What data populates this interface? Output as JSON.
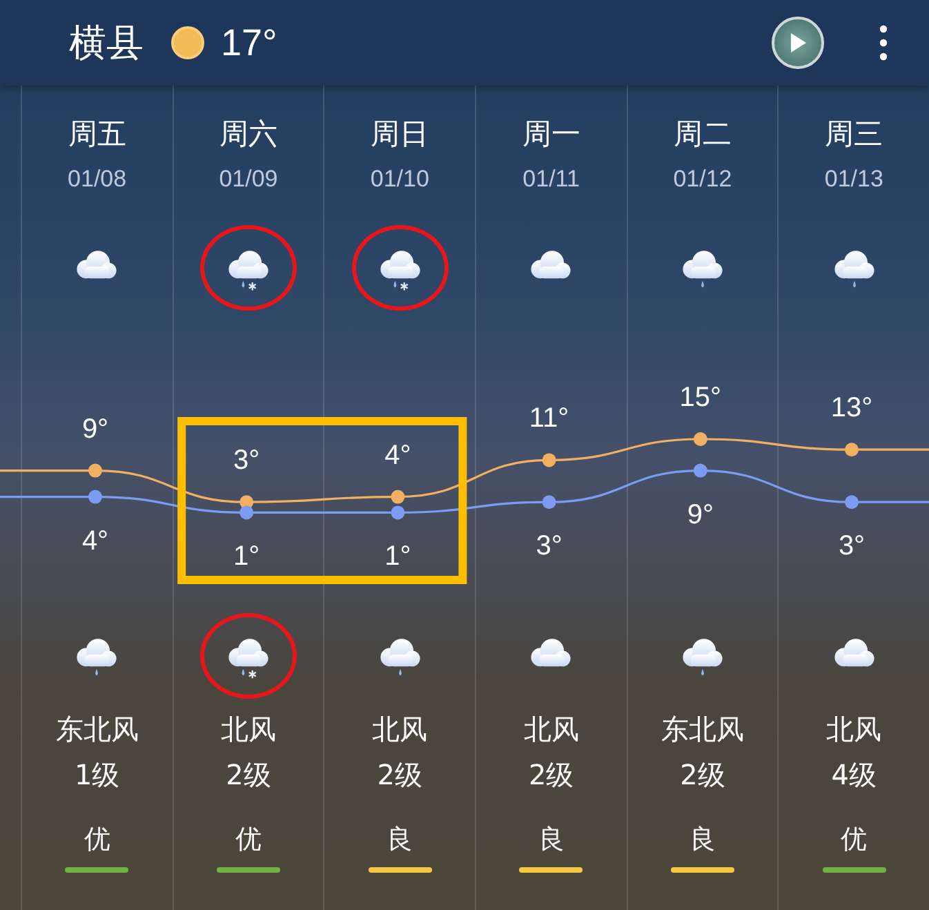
{
  "header": {
    "city": "横县",
    "temperature": "17°"
  },
  "days": [
    {
      "weekday": "周五",
      "date": "01/08",
      "day_weather": {
        "kind": "cloudy",
        "circled": false
      },
      "high": "9°",
      "low": "4°",
      "boxed": false,
      "night_weather": {
        "kind": "rain",
        "circled": false
      },
      "wind_direction": "东北风",
      "wind_level": "1级",
      "aqi": "优",
      "color": "#6db33f"
    },
    {
      "weekday": "周六",
      "date": "01/09",
      "day_weather": {
        "kind": "sleet",
        "circled": true
      },
      "high": "3°",
      "low": "1°",
      "boxed": true,
      "night_weather": {
        "kind": "sleet",
        "circled": true
      },
      "wind_direction": "北风",
      "wind_level": "2级",
      "aqi": "优",
      "color": "#6db33f"
    },
    {
      "weekday": "周日",
      "date": "01/10",
      "day_weather": {
        "kind": "sleet",
        "circled": true
      },
      "high": "4°",
      "low": "1°",
      "boxed": true,
      "night_weather": {
        "kind": "rain",
        "circled": false
      },
      "wind_direction": "北风",
      "wind_level": "2级",
      "aqi": "良",
      "color": "#f5c842"
    },
    {
      "weekday": "周一",
      "date": "01/11",
      "day_weather": {
        "kind": "cloudy",
        "circled": false
      },
      "high": "11°",
      "low": "3°",
      "boxed": false,
      "night_weather": {
        "kind": "cloudy",
        "circled": false
      },
      "wind_direction": "北风",
      "wind_level": "2级",
      "aqi": "良",
      "color": "#f5c842"
    },
    {
      "weekday": "周二",
      "date": "01/12",
      "day_weather": {
        "kind": "rain",
        "circled": false
      },
      "high": "15°",
      "low": "9°",
      "boxed": false,
      "night_weather": {
        "kind": "rain",
        "circled": false
      },
      "wind_direction": "东北风",
      "wind_level": "2级",
      "aqi": "良",
      "color": "#f5c842"
    },
    {
      "weekday": "周三",
      "date": "01/13",
      "day_weather": {
        "kind": "rain",
        "circled": false
      },
      "high": "13°",
      "low": "3°",
      "boxed": false,
      "night_weather": {
        "kind": "cloudy",
        "circled": false
      },
      "wind_direction": "北风",
      "wind_level": "4级",
      "aqi": "优",
      "color": "#6db33f"
    }
  ]
}
